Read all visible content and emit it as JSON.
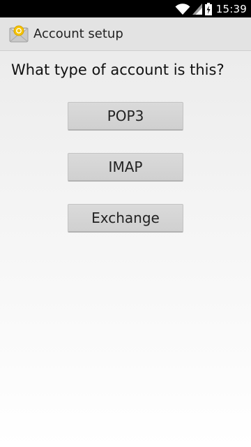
{
  "status_bar": {
    "time": "15:39",
    "icons": [
      "wifi-icon",
      "signal-icon",
      "battery-charging-icon"
    ]
  },
  "action_bar": {
    "app_icon": "email-app-icon",
    "title": "Account setup"
  },
  "main": {
    "question": "What type of account is this?",
    "buttons": {
      "pop3": "POP3",
      "imap": "IMAP",
      "exchange": "Exchange"
    }
  },
  "colors": {
    "status_bar": "#000000",
    "action_bar": "#e3e3e3",
    "button": "#d6d6d6",
    "text": "#222222"
  }
}
